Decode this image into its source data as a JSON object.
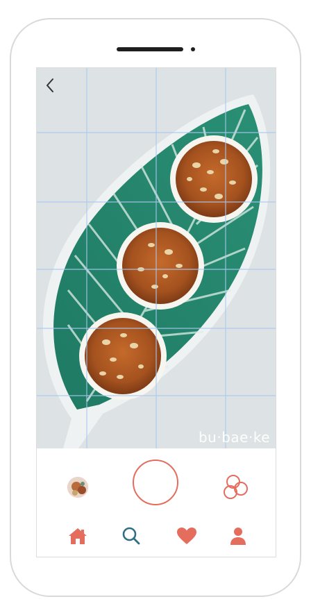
{
  "photo": {
    "watermark": "bu·bae·ke",
    "grid": "3x3"
  },
  "icons": {
    "back": "back-chevron-icon",
    "gallery": "gallery-thumbnail",
    "shutter": "shutter-icon",
    "filters": "filters-icon",
    "home": "home-icon",
    "search": "search-icon",
    "likes": "heart-icon",
    "profile": "profile-icon"
  },
  "colors": {
    "accent": "#e56d5e",
    "search": "#2f6f86",
    "grid_lines": "#a9c8ee",
    "plate": "#2a8a72"
  }
}
